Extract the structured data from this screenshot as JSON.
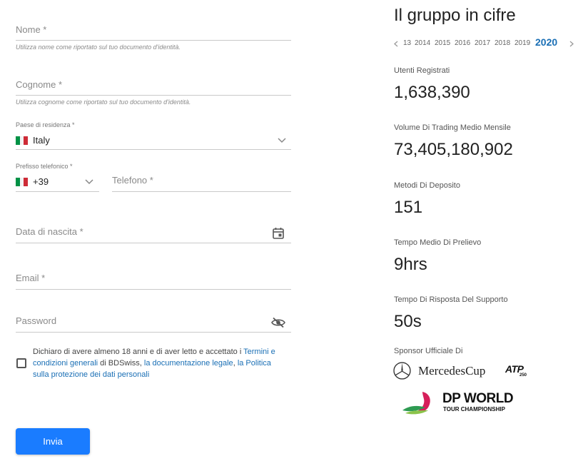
{
  "form": {
    "nome": {
      "label": "Nome *",
      "help": "Utilizza nome come riportato sul tuo documento d'identità."
    },
    "cognome": {
      "label": "Cognome *",
      "help": "Utilizza cognome come riportato sul tuo documento d'identità."
    },
    "paese": {
      "label": "Paese di residenza *",
      "value": "Italy",
      "flag_colors": [
        "#009246",
        "#ffffff",
        "#ce2b37"
      ]
    },
    "prefisso": {
      "label": "Prefisso telefonico *",
      "value": "+39"
    },
    "telefono": {
      "label": "Telefono *"
    },
    "data_nascita": {
      "label": "Data di nascita *"
    },
    "email": {
      "label": "Email *"
    },
    "password": {
      "label": "Password"
    },
    "consent": {
      "text_1": "Dichiaro di avere almeno 18 anni e di aver letto e accettato i ",
      "link_1": "Termini e condizioni generali",
      "text_2": " di BDSwiss, ",
      "link_2": "la documentazione legale",
      "text_3": ", ",
      "link_3": "la Politica sulla protezione dei dati personali"
    },
    "submit_label": "Invia"
  },
  "panel": {
    "title": "Il gruppo in cifre",
    "years": [
      "13",
      "2014",
      "2015",
      "2016",
      "2017",
      "2018",
      "2019",
      "2020"
    ],
    "active_year": "2020",
    "stats": [
      {
        "label": "Utenti Registrati",
        "value": "1,638,390"
      },
      {
        "label": "Volume Di Trading Medio Mensile",
        "value": "73,405,180,902"
      },
      {
        "label": "Metodi Di Deposito",
        "value": "151"
      },
      {
        "label": "Tempo Medio Di Prelievo",
        "value": "9hrs"
      },
      {
        "label": "Tempo Di Risposta Del Supporto",
        "value": "50s"
      }
    ],
    "sponsor_label": "Sponsor Ufficiale Di",
    "sponsors": {
      "mercedes": "MercedesCup",
      "atp": "ATP",
      "atp_sub": "250",
      "dp_world_1": "DP WORLD",
      "dp_world_2": "TOUR CHAMPIONSHIP"
    }
  },
  "colors": {
    "accent": "#1a7cff",
    "link": "#1a6fb5"
  }
}
